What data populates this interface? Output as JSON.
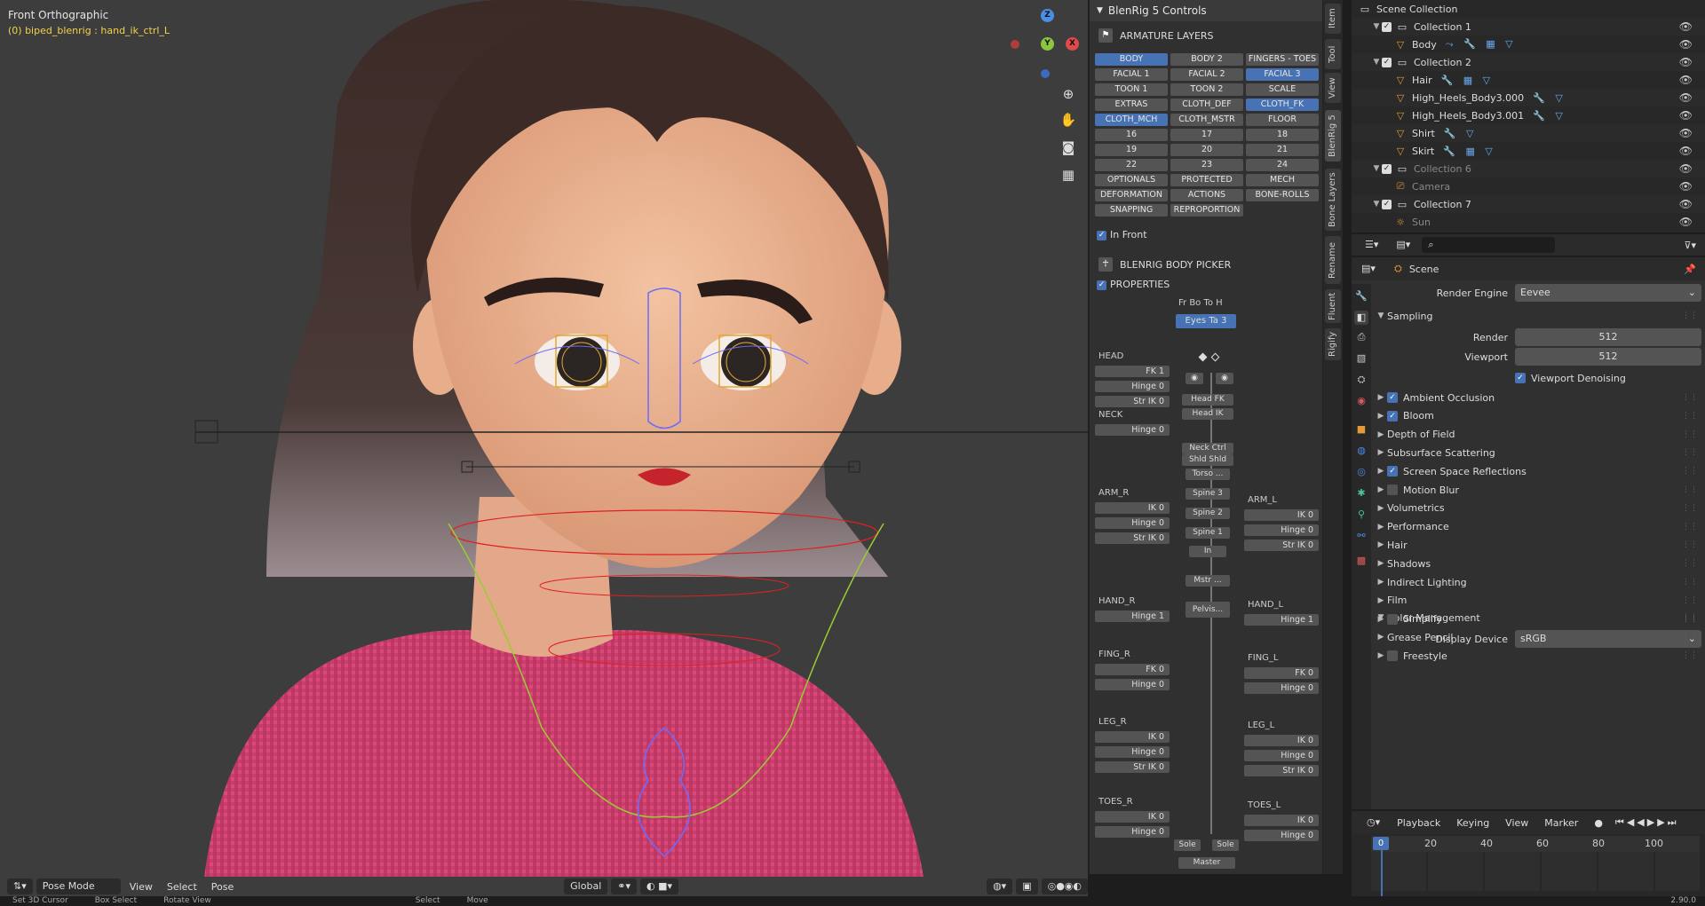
{
  "viewport": {
    "view_name": "Front Orthographic",
    "active_object": "(0) biped_blenrig : hand_ik_ctrl_L",
    "gizmo": {
      "z": "Z",
      "y": "Y",
      "x": "X"
    },
    "header": {
      "mode": "Pose Mode",
      "menus": [
        "View",
        "Select",
        "Pose"
      ],
      "transform_orientation": "Global"
    }
  },
  "blenrig": {
    "title": "BlenRig 5 Controls",
    "armature_layers_label": "ARMATURE LAYERS",
    "layers": [
      {
        "label": "BODY",
        "on": true
      },
      {
        "label": "BODY 2",
        "on": false
      },
      {
        "label": "FINGERS - TOES",
        "on": false
      },
      {
        "label": "FACIAL 1",
        "on": false
      },
      {
        "label": "FACIAL 2",
        "on": false
      },
      {
        "label": "FACIAL 3",
        "on": true
      },
      {
        "label": "TOON 1",
        "on": false
      },
      {
        "label": "TOON 2",
        "on": false
      },
      {
        "label": "SCALE",
        "on": false
      },
      {
        "label": "EXTRAS",
        "on": false
      },
      {
        "label": "CLOTH_DEF",
        "on": false
      },
      {
        "label": "CLOTH_FK",
        "on": true
      },
      {
        "label": "CLOTH_MCH",
        "on": true
      },
      {
        "label": "CLOTH_MSTR",
        "on": false
      },
      {
        "label": "FLOOR",
        "on": false
      },
      {
        "label": "16",
        "on": false
      },
      {
        "label": "17",
        "on": false
      },
      {
        "label": "18",
        "on": false
      },
      {
        "label": "19",
        "on": false
      },
      {
        "label": "20",
        "on": false
      },
      {
        "label": "21",
        "on": false
      },
      {
        "label": "22",
        "on": false
      },
      {
        "label": "23",
        "on": false
      },
      {
        "label": "24",
        "on": false
      },
      {
        "label": "OPTIONALS",
        "on": false
      },
      {
        "label": "PROTECTED",
        "on": false
      },
      {
        "label": "MECH",
        "on": false
      },
      {
        "label": "DEFORMATION",
        "on": false
      },
      {
        "label": "ACTIONS",
        "on": false
      },
      {
        "label": "BONE-ROLLS",
        "on": false
      },
      {
        "label": "SNAPPING",
        "on": false
      },
      {
        "label": "REPROPORTION",
        "on": false
      }
    ],
    "in_front_label": "In Front",
    "body_picker_label": "BLENRIG BODY PICKER",
    "properties_label": "PROPERTIES",
    "picker_tabs": "Fr  Bo  To  H",
    "eyes_button": "Eyes Ta  3",
    "picker": {
      "head": {
        "label": "HEAD",
        "buttons": [
          "FK 1",
          "Hinge 0",
          "Str IK 0"
        ]
      },
      "neck": {
        "label": "NECK",
        "buttons": [
          "Hinge 0"
        ]
      },
      "arm_r": {
        "label": "ARM_R",
        "buttons": [
          "IK 0",
          "Hinge 0",
          "Str IK 0"
        ]
      },
      "arm_l": {
        "label": "ARM_L",
        "buttons": [
          "IK 0",
          "Hinge 0",
          "Str IK 0"
        ]
      },
      "hand_r": {
        "label": "HAND_R",
        "buttons": [
          "Hinge 1"
        ]
      },
      "hand_l": {
        "label": "HAND_L",
        "buttons": [
          "Hinge 1"
        ]
      },
      "fing_r": {
        "label": "FING_R",
        "buttons": [
          "FK 0",
          "Hinge 0"
        ]
      },
      "fing_l": {
        "label": "FING_L",
        "buttons": [
          "FK 0",
          "Hinge 0"
        ]
      },
      "leg_r": {
        "label": "LEG_R",
        "buttons": [
          "IK 0",
          "Hinge 0",
          "Str IK 0"
        ]
      },
      "leg_l": {
        "label": "LEG_L",
        "buttons": [
          "IK 0",
          "Hinge 0",
          "Str IK 0"
        ]
      },
      "toes_r": {
        "label": "TOES_R",
        "buttons": [
          "IK 0",
          "Hinge 0"
        ]
      },
      "toes_l": {
        "label": "TOES_L",
        "buttons": [
          "IK 0",
          "Hinge 0"
        ]
      }
    },
    "center": {
      "head_fk": "Head FK",
      "head_ik": "Head IK",
      "neck_ctrl": "Neck Ctrl",
      "shld": "Shld Shld",
      "torso": "Torso ...",
      "spine3": "Spine 3",
      "spine2": "Spine 2",
      "spine1": "Spine 1",
      "in": "In",
      "mstr": "Mstr ...",
      "pelvis": "Pelvis...",
      "sole_r": "Sole",
      "sole_l": "Sole",
      "master": "Master"
    }
  },
  "side_tabs": [
    "Item",
    "Tool",
    "View",
    "BlenRig 5",
    "Bone Layers",
    "Rename",
    "Fluent",
    "Rigify"
  ],
  "outliner": {
    "rows": [
      {
        "name": "Scene Collection",
        "indent": 0,
        "type": "scene",
        "dim": false
      },
      {
        "name": "Collection 1",
        "indent": 1,
        "type": "collection",
        "dim": false
      },
      {
        "name": "Body",
        "indent": 2,
        "type": "mesh",
        "dim": false,
        "mods": "⤳ 🔧 ▦ ▽"
      },
      {
        "name": "Collection 2",
        "indent": 1,
        "type": "collection",
        "dim": false
      },
      {
        "name": "Hair",
        "indent": 2,
        "type": "mesh",
        "dim": false,
        "mods": "🔧 ▦ ▽"
      },
      {
        "name": "High_Heels_Body3.000",
        "indent": 2,
        "type": "mesh",
        "dim": false,
        "mods": "🔧 ▽"
      },
      {
        "name": "High_Heels_Body3.001",
        "indent": 2,
        "type": "mesh",
        "dim": false,
        "mods": "🔧 ▽"
      },
      {
        "name": "Shirt",
        "indent": 2,
        "type": "mesh",
        "dim": false,
        "mods": "🔧 ▽"
      },
      {
        "name": "Skirt",
        "indent": 2,
        "type": "mesh",
        "dim": false,
        "mods": "🔧 ▦ ▽"
      },
      {
        "name": "Collection 6",
        "indent": 1,
        "type": "collection",
        "dim": true
      },
      {
        "name": "Camera",
        "indent": 2,
        "type": "camera",
        "dim": true
      },
      {
        "name": "Collection 7",
        "indent": 1,
        "type": "collection",
        "dim": false
      },
      {
        "name": "Sun",
        "indent": 2,
        "type": "light",
        "dim": true
      }
    ]
  },
  "properties": {
    "scene_label": "Scene",
    "render_engine_label": "Render Engine",
    "render_engine": "Eevee",
    "sampling_label": "Sampling",
    "render_label": "Render",
    "render_value": "512",
    "viewport_label": "Viewport",
    "viewport_value": "512",
    "viewport_denoising": "Viewport Denoising",
    "panels": [
      {
        "label": "Ambient Occlusion",
        "check": true
      },
      {
        "label": "Bloom",
        "check": true
      },
      {
        "label": "Depth of Field",
        "check": null
      },
      {
        "label": "Subsurface Scattering",
        "check": null
      },
      {
        "label": "Screen Space Reflections",
        "check": true
      },
      {
        "label": "Motion Blur",
        "check": false
      },
      {
        "label": "Volumetrics",
        "check": null
      },
      {
        "label": "Performance",
        "check": null
      },
      {
        "label": "Hair",
        "check": null
      },
      {
        "label": "Shadows",
        "check": null
      },
      {
        "label": "Indirect Lighting",
        "check": null
      },
      {
        "label": "Film",
        "check": null
      },
      {
        "label": "Simplify",
        "check": false
      },
      {
        "label": "Grease Pencil",
        "check": null
      },
      {
        "label": "Freestyle",
        "check": false
      }
    ],
    "color_management_label": "Color Management",
    "display_device_label": "Display Device",
    "display_device": "sRGB"
  },
  "timeline": {
    "menus": [
      "Playback",
      "Keying",
      "View",
      "Marker"
    ],
    "current_frame": "0",
    "ticks": [
      "20",
      "40",
      "60",
      "80",
      "100"
    ]
  },
  "status_bar": [
    "Set 3D Cursor",
    "Box Select",
    "Rotate View",
    "Select",
    "Move",
    "2.90.0"
  ],
  "colors": {
    "accent": "#4772b3",
    "active_text": "#f3d24a",
    "bg": "#3d3d3d"
  }
}
